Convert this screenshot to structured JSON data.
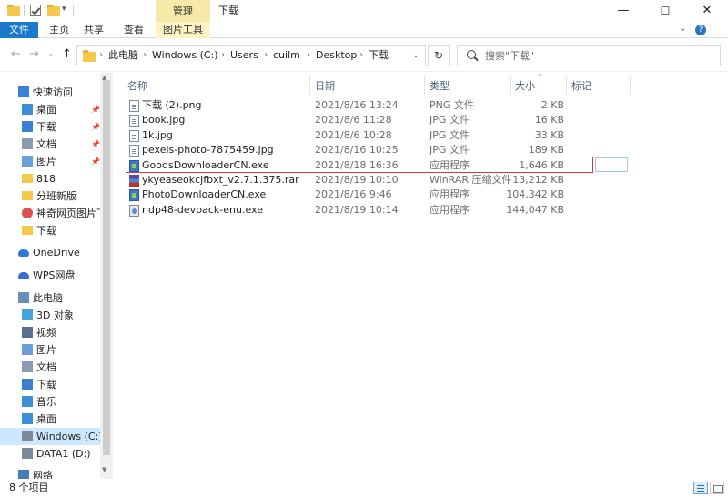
{
  "window": {
    "title": "下载",
    "context_tab": "管理",
    "controls": {
      "minimize": "—",
      "maximize": "☐",
      "close": "✕"
    }
  },
  "ribbon": {
    "tabs": [
      "文件",
      "主页",
      "共享",
      "查看",
      "图片工具"
    ]
  },
  "address": {
    "crumbs": [
      "此电脑",
      "Windows (C:)",
      "Users",
      "cuilm",
      "Desktop",
      "下载"
    ],
    "search_placeholder": "搜索\"下载\""
  },
  "nav": {
    "items": [
      {
        "label": "快速访问",
        "icon": "star-icon",
        "pinned": false
      },
      {
        "label": "桌面",
        "icon": "desktop-icon",
        "pinned": true
      },
      {
        "label": "下载",
        "icon": "download-icon",
        "pinned": true
      },
      {
        "label": "文档",
        "icon": "document-icon",
        "pinned": true
      },
      {
        "label": "图片",
        "icon": "pictures-icon",
        "pinned": true
      },
      {
        "label": "818",
        "icon": "folder-icon",
        "pinned": false
      },
      {
        "label": "分班新版",
        "icon": "folder-icon",
        "pinned": false
      },
      {
        "label": "神奇网页图片下载",
        "icon": "app-icon",
        "pinned": false
      },
      {
        "label": "下载",
        "icon": "folder-icon",
        "pinned": false
      },
      {
        "label": "OneDrive",
        "icon": "cloud-icon",
        "pinned": false
      },
      {
        "label": "WPS网盘",
        "icon": "wps-cloud-icon",
        "pinned": false
      },
      {
        "label": "此电脑",
        "icon": "computer-icon",
        "pinned": false
      },
      {
        "label": "3D 对象",
        "icon": "3d-objects-icon",
        "pinned": false
      },
      {
        "label": "视频",
        "icon": "video-icon",
        "pinned": false
      },
      {
        "label": "图片",
        "icon": "pictures-icon",
        "pinned": false
      },
      {
        "label": "文档",
        "icon": "document-icon",
        "pinned": false
      },
      {
        "label": "下载",
        "icon": "download-icon",
        "pinned": false
      },
      {
        "label": "音乐",
        "icon": "music-icon",
        "pinned": false
      },
      {
        "label": "桌面",
        "icon": "desktop-icon",
        "pinned": false
      },
      {
        "label": "Windows (C:)",
        "icon": "drive-icon",
        "pinned": false,
        "selected": true
      },
      {
        "label": "DATA1 (D:)",
        "icon": "drive-icon",
        "pinned": false
      },
      {
        "label": "网络",
        "icon": "network-icon",
        "pinned": false
      }
    ]
  },
  "columns": {
    "name": "名称",
    "date": "日期",
    "type": "类型",
    "size": "大小",
    "tags": "标记"
  },
  "files": [
    {
      "name": "下载 (2).png",
      "date": "2021/8/16 13:24",
      "type": "PNG 文件",
      "size": "2 KB",
      "icon": "image-file-icon"
    },
    {
      "name": "book.jpg",
      "date": "2021/8/6 11:28",
      "type": "JPG 文件",
      "size": "16 KB",
      "icon": "image-file-icon"
    },
    {
      "name": "1k.jpg",
      "date": "2021/8/6 10:28",
      "type": "JPG 文件",
      "size": "33 KB",
      "icon": "image-file-icon"
    },
    {
      "name": "pexels-photo-7875459.jpg",
      "date": "2021/8/16 10:25",
      "type": "JPG 文件",
      "size": "189 KB",
      "icon": "image-file-icon"
    },
    {
      "name": "GoodsDownloaderCN.exe",
      "date": "2021/8/18 16:36",
      "type": "应用程序",
      "size": "1,646 KB",
      "icon": "exe-icon",
      "highlighted": true
    },
    {
      "name": "ykyeaseokcjfbxt_v2.7.1.375.rar",
      "date": "2021/8/19 10:10",
      "type": "WinRAR 压缩文件",
      "size": "13,212 KB",
      "icon": "rar-icon"
    },
    {
      "name": "PhotoDownloaderCN.exe",
      "date": "2021/8/16 9:46",
      "type": "应用程序",
      "size": "104,342 KB",
      "icon": "exe-icon"
    },
    {
      "name": "ndp48-devpack-enu.exe",
      "date": "2021/8/19 10:14",
      "type": "应用程序",
      "size": "144,047 KB",
      "icon": "installer-icon"
    }
  ],
  "status": {
    "text": "8 个项目"
  },
  "colors": {
    "accent": "#1979ca",
    "selection": "#cce8ff",
    "highlight_border": "#d33a3a",
    "context_tab": "#f7e9a8"
  }
}
